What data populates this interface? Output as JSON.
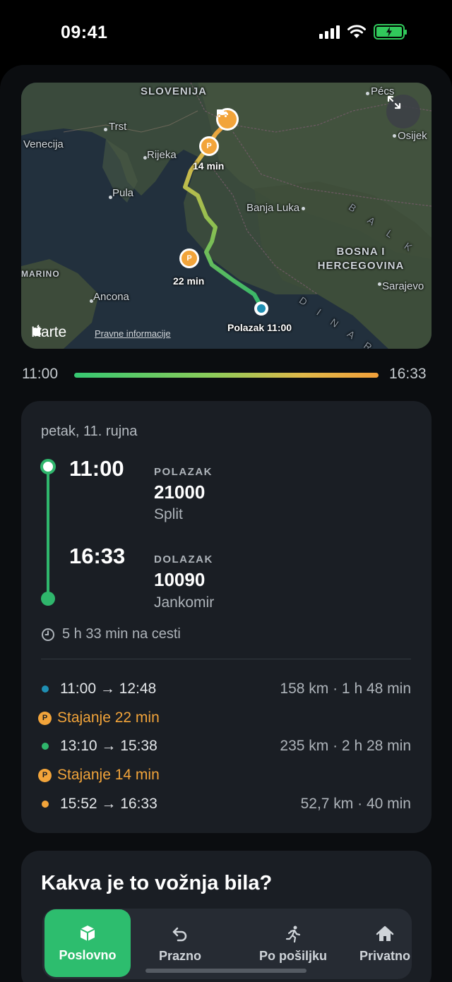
{
  "status_bar": {
    "time": "09:41"
  },
  "map": {
    "labels": {
      "slovenia": "SLOVENIJA",
      "pecs": "Pécs",
      "trst": "Trst",
      "osijek": "Osijek",
      "venecija": "Venecija",
      "rijeka": "Rijeka",
      "pula": "Pula",
      "banja_luka": "Banja Luka",
      "balkan": "B A L K",
      "bosnia_line1": "BOSNA I",
      "bosnia_line2": "HERCEGOVINA",
      "marino": "MARINO",
      "sarajevo": "Sarajevo",
      "ancona": "Ancona",
      "dinaridi": "D I N A R I D"
    },
    "stop1_time": "14 min",
    "stop2_time": "22 min",
    "parking_letter": "P",
    "origin_label": "Polazak 11:00",
    "brand": "Karte",
    "legal": "Pravne informacije"
  },
  "timebar": {
    "start": "11:00",
    "end": "16:33"
  },
  "trip": {
    "date": "petak, 11. rujna",
    "departure": {
      "time": "11:00",
      "kind": "POLAZAK",
      "code": "21000",
      "city": "Split"
    },
    "arrival": {
      "time": "16:33",
      "kind": "DOLAZAK",
      "code": "10090",
      "city": "Jankomir"
    },
    "duration": "5 h 33 min na cesti",
    "segments": [
      {
        "times": "11:00 → 12:48",
        "meta": "158 km · 1 h 48 min",
        "color": "#1f8fb3"
      },
      {
        "stop": "Stajanje 22 min"
      },
      {
        "times": "13:10 → 15:38",
        "meta": "235 km · 2 h 28 min",
        "color": "#2fb66c"
      },
      {
        "stop": "Stajanje 14 min"
      },
      {
        "times": "15:52 → 16:33",
        "meta": "52,7 km · 40 min",
        "color": "#f2a43a"
      }
    ]
  },
  "feedback": {
    "question": "Kakva je to vožnja bila?",
    "options": [
      {
        "label": "Poslovno",
        "icon": "package-icon",
        "selected": true
      },
      {
        "label": "Prazno",
        "icon": "return-arrow-icon",
        "selected": false
      },
      {
        "label": "Po pošiljku",
        "icon": "running-person-icon",
        "selected": false
      },
      {
        "label": "Privatno",
        "icon": "home-icon",
        "selected": false
      }
    ]
  },
  "colors": {
    "accent_green": "#2dbd6e",
    "accent_orange": "#f2a43a",
    "accent_blue": "#1f8fb3"
  }
}
